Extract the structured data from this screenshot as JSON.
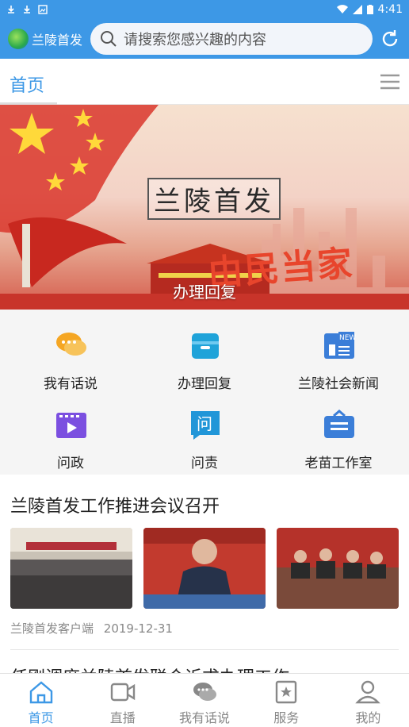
{
  "status": {
    "time": "4:41"
  },
  "header": {
    "app_name": "兰陵首发",
    "search_placeholder": "请搜索您感兴趣的内容"
  },
  "tabs": {
    "home": "首页"
  },
  "banner": {
    "slogan": "由民当家",
    "title": "兰陵首发",
    "caption": "办理回复"
  },
  "functions": [
    {
      "label": "我有话说",
      "icon": "chat-bubbles-icon",
      "color": "#f5a623"
    },
    {
      "label": "办理回复",
      "icon": "inbox-icon",
      "color": "#1fa3d9"
    },
    {
      "label": "兰陵社会新闻",
      "icon": "news-icon",
      "color": "#3b7ed8"
    },
    {
      "label": "问政",
      "icon": "video-icon",
      "color": "#7b4fe0"
    },
    {
      "label": "问责",
      "icon": "ask-icon",
      "color": "#2196d8"
    },
    {
      "label": "老苗工作室",
      "icon": "briefcase-icon",
      "color": "#3b7ed8"
    }
  ],
  "article": {
    "title": "兰陵首发工作推进会议召开",
    "source": "兰陵首发客户端",
    "date": "2019-12-31",
    "next_title": "任刚调度兰陵首发联合诉求办理工作"
  },
  "bottom_nav": [
    {
      "label": "首页",
      "icon": "home-icon",
      "active": true
    },
    {
      "label": "直播",
      "icon": "video-camera-icon",
      "active": false
    },
    {
      "label": "我有话说",
      "icon": "chat-icon",
      "active": false
    },
    {
      "label": "服务",
      "icon": "star-doc-icon",
      "active": false
    },
    {
      "label": "我的",
      "icon": "user-icon",
      "active": false
    }
  ],
  "colors": {
    "primary": "#3d98e6",
    "background": "#f5f5f5"
  }
}
